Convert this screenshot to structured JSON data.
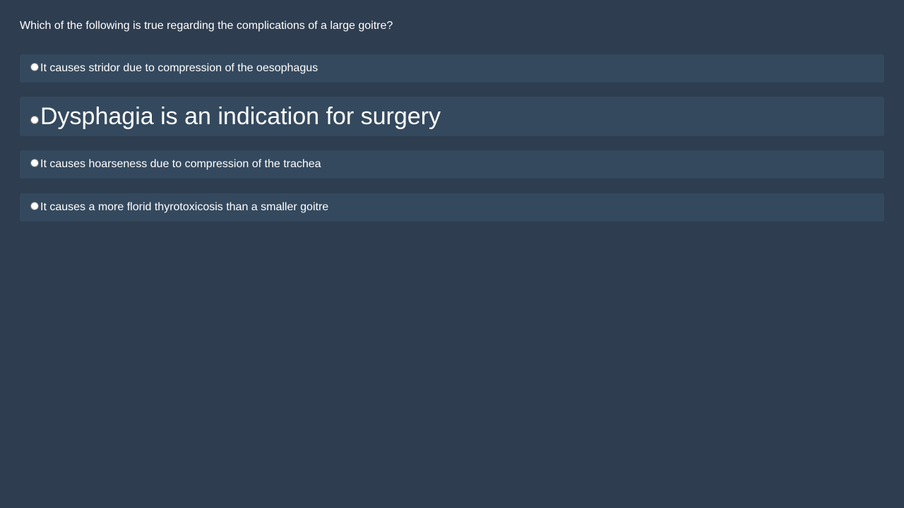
{
  "question": {
    "text": "Which of the following is true regarding the complications of a large goitre?"
  },
  "options": [
    {
      "label": "It causes stridor due to compression of the oesophagus"
    },
    {
      "label": "Dysphagia is an indication for surgery"
    },
    {
      "label": "It causes hoarseness due to compression of the trachea"
    },
    {
      "label": "It causes a more florid thyrotoxicosis than a smaller goitre"
    }
  ],
  "colors": {
    "background": "#2e3d4f",
    "option_background": "#34495e",
    "text": "#ffffff"
  }
}
